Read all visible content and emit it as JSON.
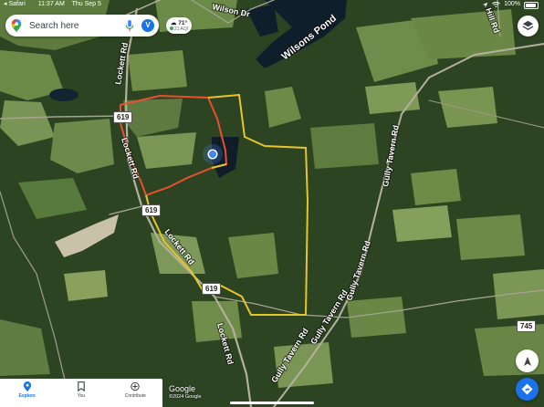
{
  "status_bar": {
    "back_app": "Safari",
    "time": "11:37 AM",
    "date": "Thu Sep 5",
    "battery": "100%"
  },
  "search": {
    "placeholder": "Search here",
    "avatar_letter": "V"
  },
  "weather": {
    "temperature": "71°",
    "aqi": "21 AQI"
  },
  "map": {
    "labels": {
      "pond": "Wilsons Pond",
      "road_lockett_north": "Lockett Rd",
      "road_lockett_mid": "Lockett Rd",
      "road_lockett_south": "Lockett Rd",
      "road_lockett_far_south": "Lockett Rd",
      "road_wilson": "Wilson Dr",
      "road_gully_tavern_east": "Gully Tavern Rd",
      "road_gully_tavern_ne": "Gully Tavern Rd",
      "road_gully_tavern_south": "Gully Tavern Rd",
      "road_gully_tavern_mid": "Gully Tavern Rd",
      "road_hill": "Hill Rd"
    },
    "shields": [
      "619",
      "619",
      "619",
      "745"
    ],
    "colors": {
      "boundary_red": "#e8502f",
      "boundary_yellow": "#e6c52c",
      "water": "#0f1e2b",
      "forest": "#2c4422",
      "field": "#6d8a4a"
    }
  },
  "bottom_nav": {
    "items": [
      {
        "label": "Explore",
        "icon": "location-pin-icon",
        "active": true
      },
      {
        "label": "You",
        "icon": "bookmark-icon",
        "active": false
      },
      {
        "label": "Contribute",
        "icon": "add-circle-icon",
        "active": false
      }
    ]
  },
  "attribution": {
    "logo": "Google",
    "copyright": "©2024 Google"
  }
}
